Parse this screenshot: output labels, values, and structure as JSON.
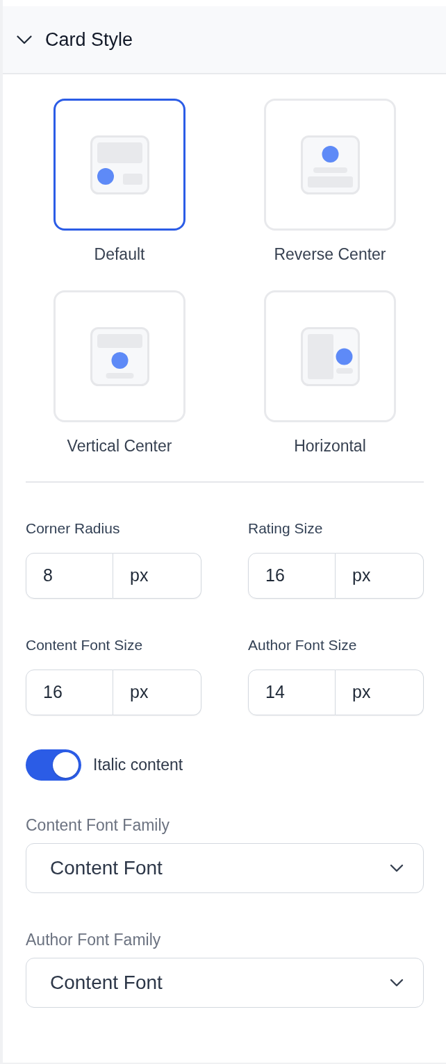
{
  "section": {
    "title": "Card Style",
    "expanded": true
  },
  "layouts": [
    {
      "label": "Default",
      "kind": "default",
      "selected": true
    },
    {
      "label": "Reverse Center",
      "kind": "reverse_center",
      "selected": false
    },
    {
      "label": "Vertical Center",
      "kind": "vertical_center",
      "selected": false
    },
    {
      "label": "Horizontal",
      "kind": "horizontal",
      "selected": false
    }
  ],
  "size_fields": [
    {
      "label": "Corner Radius",
      "value": "8",
      "unit": "px"
    },
    {
      "label": "Rating Size",
      "value": "16",
      "unit": "px"
    },
    {
      "label": "Content Font Size",
      "value": "16",
      "unit": "px"
    },
    {
      "label": "Author Font Size",
      "value": "14",
      "unit": "px"
    }
  ],
  "italic_toggle": {
    "label": "Italic content",
    "on": true
  },
  "font_selects": [
    {
      "label": "Content Font Family",
      "value": "Content Font"
    },
    {
      "label": "Author Font Family",
      "value": "Content Font"
    }
  ]
}
